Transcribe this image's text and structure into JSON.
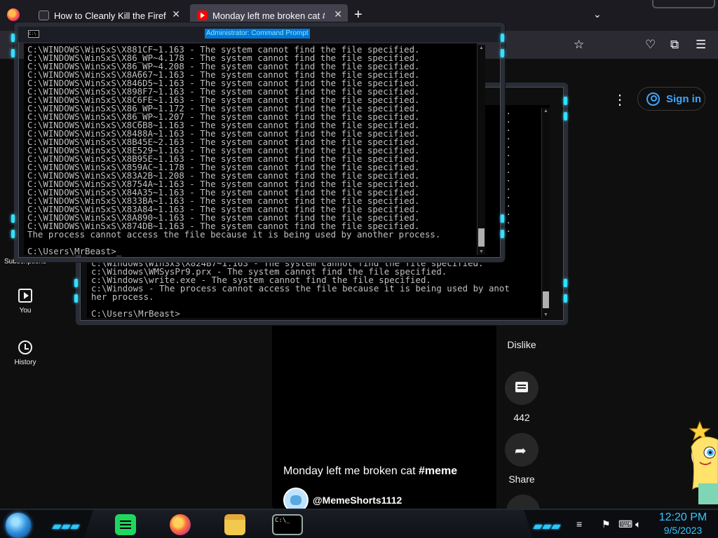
{
  "browser": {
    "tabs": [
      {
        "label": "How to Cleanly Kill the Firefox.e",
        "close": "✕"
      },
      {
        "label": "Monday left me broken cat #m",
        "close": "✕"
      }
    ],
    "new_tab": "+",
    "tab_list": "⌄"
  },
  "youtube": {
    "sign_in": "Sign in",
    "kebab": "⋮",
    "sidebar": {
      "subscriptions_label": "Subscriptions",
      "you_label": "You",
      "history_label": "History"
    },
    "video": {
      "title_text": "Monday left me broken cat ",
      "title_tag": "#meme",
      "channel": "@MemeShorts1112"
    },
    "actions": {
      "dislike_label": "Dislike",
      "comments_count": "442",
      "share_label": "Share"
    }
  },
  "cmd_front": {
    "title": "Administrator: Command Prompt",
    "lines": [
      "C:\\WINDOWS\\WinSxS\\X881CF~1.163 - The system cannot find the file specified.",
      "C:\\WINDOWS\\WinSxS\\X86_WP~4.178 - The system cannot find the file specified.",
      "C:\\WINDOWS\\WinSxS\\X86_WP~4.208 - The system cannot find the file specified.",
      "C:\\WINDOWS\\WinSxS\\X8A667~1.163 - The system cannot find the file specified.",
      "C:\\WINDOWS\\WinSxS\\X846D5~1.163 - The system cannot find the file specified.",
      "C:\\WINDOWS\\WinSxS\\X898F7~1.163 - The system cannot find the file specified.",
      "C:\\WINDOWS\\WinSxS\\X8C6FE~1.163 - The system cannot find the file specified.",
      "C:\\WINDOWS\\WinSxS\\X86_WP~1.172 - The system cannot find the file specified.",
      "C:\\WINDOWS\\WinSxS\\X86_WP~1.207 - The system cannot find the file specified.",
      "C:\\WINDOWS\\WinSxS\\X8C6B8~1.163 - The system cannot find the file specified.",
      "C:\\WINDOWS\\WinSxS\\X8488A~1.163 - The system cannot find the file specified.",
      "C:\\WINDOWS\\WinSxS\\X8B45E~2.163 - The system cannot find the file specified.",
      "C:\\WINDOWS\\WinSxS\\X8E529~1.163 - The system cannot find the file specified.",
      "C:\\WINDOWS\\WinSxS\\X8B95E~1.163 - The system cannot find the file specified.",
      "C:\\WINDOWS\\WinSxS\\X859AC~1.178 - The system cannot find the file specified.",
      "C:\\WINDOWS\\WinSxS\\X83A2B~1.208 - The system cannot find the file specified.",
      "C:\\WINDOWS\\WinSxS\\X8754A~1.163 - The system cannot find the file specified.",
      "C:\\WINDOWS\\WinSxS\\X84A35~1.163 - The system cannot find the file specified.",
      "C:\\WINDOWS\\WinSxS\\X833BA~1.163 - The system cannot find the file specified.",
      "C:\\WINDOWS\\WinSxS\\X83A84~1.163 - The system cannot find the file specified.",
      "C:\\WINDOWS\\WinSxS\\X8A890~1.163 - The system cannot find the file specified.",
      "C:\\WINDOWS\\WinSxS\\X874DB~1.163 - The system cannot find the file specified."
    ],
    "error_line": "The process cannot access the file because it is being used by another process.",
    "prompt": "C:\\Users\\MrBeast>_"
  },
  "cmd_back": {
    "right_edge": [
      "d.",
      "d.",
      "d.",
      "d.",
      "d.",
      "d.",
      "d.",
      "d.",
      "d.",
      "d.",
      "d.",
      "d.",
      "d.",
      "d.",
      "d."
    ],
    "lines": [
      "c:\\Windows\\WinSxS\\X824B7~1.163 - The system cannot find the file specified.",
      "c:\\Windows\\WMSysPr9.prx - The system cannot find the file specified.",
      "c:\\Windows\\write.exe - The system cannot find the file specified.",
      "c:\\Windows - The process cannot access the file because it is being used by anot",
      "her process."
    ],
    "prompt": "C:\\Users\\MrBeast>"
  },
  "taskbar": {
    "cmd_label": "C:\\_",
    "time": "12:20 PM",
    "date": "9/5/2023"
  }
}
